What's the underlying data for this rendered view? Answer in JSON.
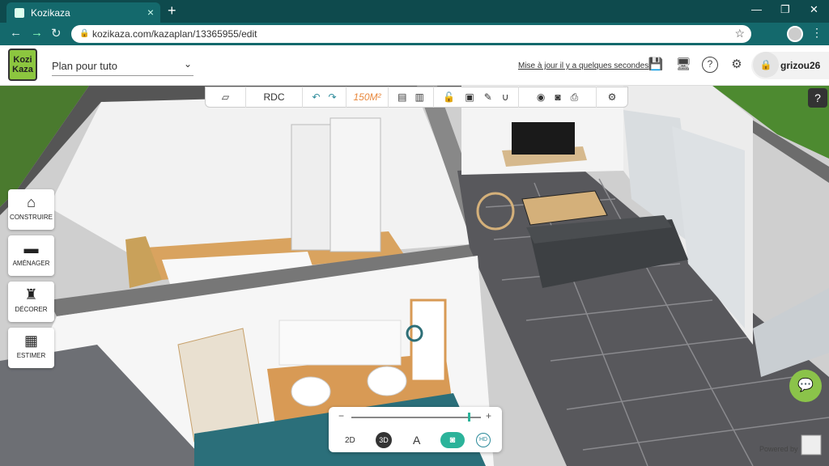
{
  "browser": {
    "tab_title": "Kozikaza",
    "url": "kozikaza.com/kazaplan/13365955/edit"
  },
  "app": {
    "logo_text": "Kozi Kaza",
    "plan_name": "Plan pour tuto",
    "save_status": "Mise à jour il y a quelques secondes",
    "username": "grizou26"
  },
  "toolbar": {
    "floor": "RDC",
    "area": "150M²"
  },
  "sidebar": {
    "items": [
      {
        "label": "CONSTRUIRE",
        "icon": "house-icon"
      },
      {
        "label": "AMÉNAGER",
        "icon": "sofa-icon"
      },
      {
        "label": "DÉCORER",
        "icon": "lamp-icon"
      },
      {
        "label": "ESTIMER",
        "icon": "clipboard-icon"
      }
    ]
  },
  "view_controls": {
    "mode_2d": "2D",
    "mode_3d": "3D",
    "text_mode": "A",
    "hd": "HD",
    "zoom_level": 0.9
  },
  "footer": {
    "powered_by": "Powered by"
  },
  "colors": {
    "browser_dark": "#0e4a4d",
    "browser_tab": "#14696c",
    "accent_green": "#8cc63f",
    "camera_green": "#2bb39a",
    "floor_tile": "#58585c"
  }
}
